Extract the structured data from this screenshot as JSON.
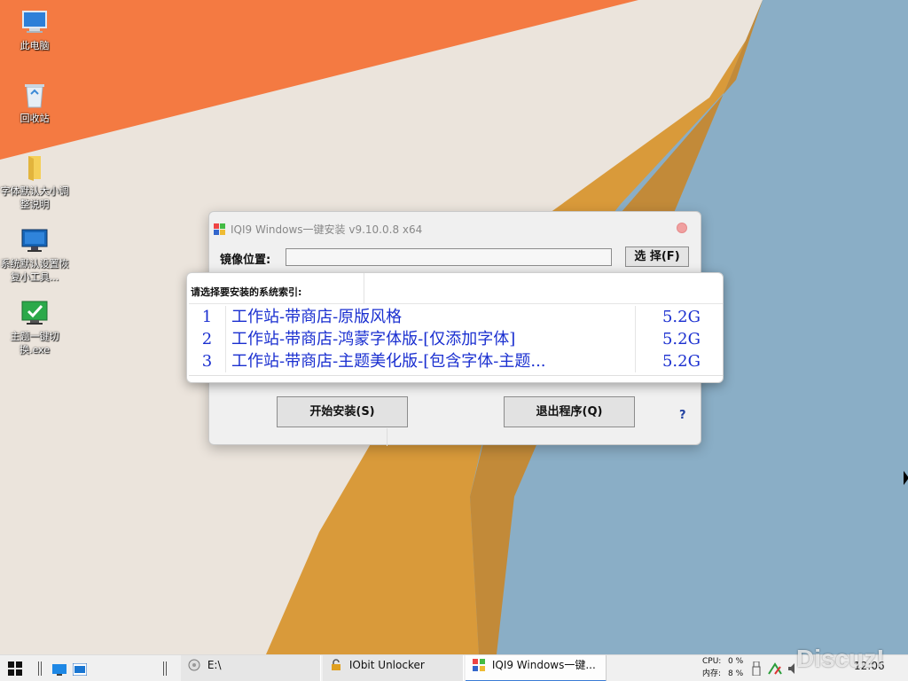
{
  "desktop": {
    "icons": [
      {
        "label": "此电脑",
        "icon": "computer-icon"
      },
      {
        "label": "回收站",
        "icon": "recycle-bin-icon"
      },
      {
        "label": "字体默认大小调整说明",
        "icon": "folder-icon"
      },
      {
        "label": "系统默认设置恢复小工具...",
        "icon": "monitor-icon"
      },
      {
        "label": "主题一键切换.exe",
        "icon": "checkmark-app-icon"
      }
    ]
  },
  "installer": {
    "title": "IQI9 Windows一键安装 v9.10.0.8 x64",
    "image_label": "镜像位置:",
    "image_value": "",
    "select_button": "选 择(F)",
    "install_button": "开始安装(S)",
    "exit_button": "退出程序(Q)",
    "help": "?"
  },
  "index_popup": {
    "prompt": "请选择要安装的系统索引:",
    "items": [
      {
        "index": "1",
        "name": "工作站-带商店-原版风格",
        "size": "5.2G"
      },
      {
        "index": "2",
        "name": "工作站-带商店-鸿蒙字体版-[仅添加字体]",
        "size": "5.2G"
      },
      {
        "index": "3",
        "name": "工作站-带商店-主题美化版-[包含字体-主题...",
        "size": "5.2G"
      }
    ]
  },
  "taskbar": {
    "items": [
      {
        "label": "E:\\",
        "icon": "drive-icon"
      },
      {
        "label": "IObit Unlocker",
        "icon": "unlocker-icon"
      },
      {
        "label": "IQI9 Windows一键...",
        "icon": "installer-icon"
      }
    ],
    "cpu_label": "CPU:",
    "cpu_value": "0 %",
    "mem_label": "内存:",
    "mem_value": "8 %",
    "clock": "12:06"
  },
  "watermark": "Discuz!",
  "colors": {
    "list_text": "#1a2fd0",
    "wall_orange": "#f47a42",
    "wall_gold": "#d99a3a",
    "wall_blue": "#8aaec6"
  }
}
